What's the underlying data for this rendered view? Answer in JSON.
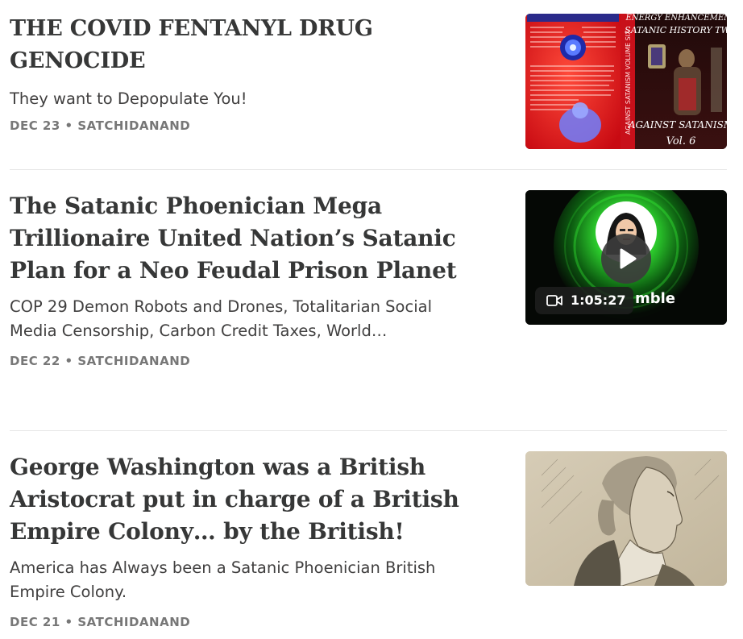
{
  "posts": [
    {
      "title": "THE COVID FENTANYL DRUG GENOCIDE",
      "subtitle": "They want to Depopulate You!",
      "date": "DEC 23",
      "author": "SATCHIDANAND",
      "thumbnail": {
        "kind": "book-cover",
        "spine_text": "AGAINST SATANISM VOLUME SIX",
        "top_text": "AGAINST SATANISM VOLUME SIX",
        "header_line1": "ENERGY ENHANCEMENT",
        "header_line2": "SATANIC HISTORY TWO",
        "footer_line1": "AGAINST SATANISM",
        "footer_line2": "Vol. 6"
      }
    },
    {
      "title": "The Satanic Phoenician Mega Trillionaire United Nation’s Satanic Plan for a Neo Feudal Prison Planet",
      "subtitle": "COP 29 Demon Robots and Drones, Totalitarian Social Media Censorship, Carbon Credit Taxes, World…",
      "date": "DEC 22",
      "author": "SATCHIDANAND",
      "thumbnail": {
        "kind": "video",
        "duration": "1:05:27",
        "brand_text": "mble",
        "icons": [
          "play-icon",
          "video-camera-icon"
        ]
      }
    },
    {
      "title": "George Washington was a British Aristocrat put in charge of a British Empire Colony… by the British!",
      "subtitle": "America has Always been a Satanic Phoenician British Empire Colony.",
      "date": "DEC 21",
      "author": "SATCHIDANAND",
      "thumbnail": {
        "kind": "portrait-engraving"
      }
    }
  ],
  "separator": " • ",
  "colors": {
    "title": "#363737",
    "meta": "#777777",
    "divider": "#e6e6e6",
    "video_glow": "#2fd62f"
  }
}
